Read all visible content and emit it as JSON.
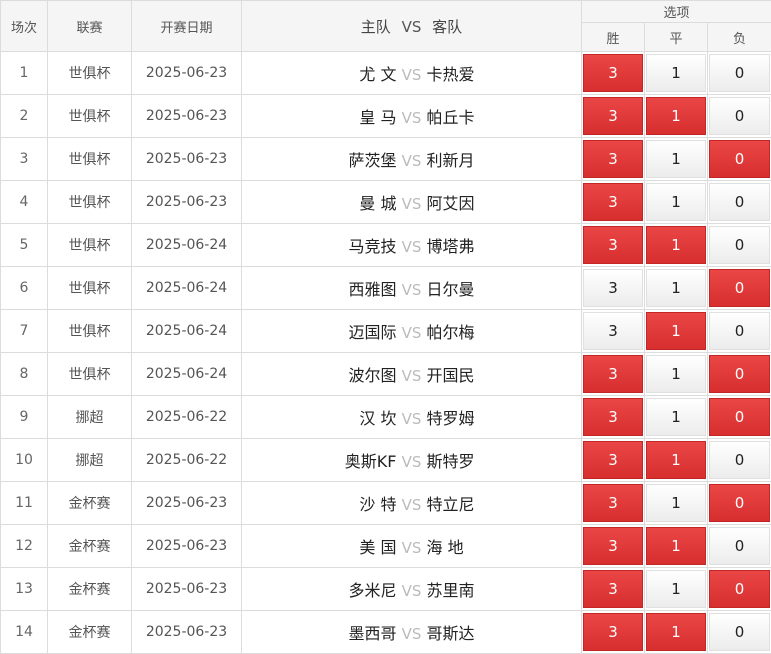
{
  "header": {
    "index_label": "场次",
    "league_label": "联赛",
    "date_label": "开赛日期",
    "home_label": "主队",
    "vs_label": "VS",
    "away_label": "客队",
    "options_label": "选项",
    "win_label": "胜",
    "draw_label": "平",
    "lose_label": "负"
  },
  "vs_text": "VS",
  "selected_color": "#e03c3c",
  "rows": [
    {
      "index": "1",
      "league": "世俱杯",
      "date": "2025-06-23",
      "home": "尤 文",
      "away": "卡热爱",
      "win": "3",
      "draw": "1",
      "lose": "0",
      "win_selected": true,
      "draw_selected": false,
      "lose_selected": false
    },
    {
      "index": "2",
      "league": "世俱杯",
      "date": "2025-06-23",
      "home": "皇 马",
      "away": "帕丘卡",
      "win": "3",
      "draw": "1",
      "lose": "0",
      "win_selected": true,
      "draw_selected": true,
      "lose_selected": false
    },
    {
      "index": "3",
      "league": "世俱杯",
      "date": "2025-06-23",
      "home": "萨茨堡",
      "away": "利新月",
      "win": "3",
      "draw": "1",
      "lose": "0",
      "win_selected": true,
      "draw_selected": false,
      "lose_selected": true
    },
    {
      "index": "4",
      "league": "世俱杯",
      "date": "2025-06-23",
      "home": "曼 城",
      "away": "阿艾因",
      "win": "3",
      "draw": "1",
      "lose": "0",
      "win_selected": true,
      "draw_selected": false,
      "lose_selected": false
    },
    {
      "index": "5",
      "league": "世俱杯",
      "date": "2025-06-24",
      "home": "马竞技",
      "away": "博塔弗",
      "win": "3",
      "draw": "1",
      "lose": "0",
      "win_selected": true,
      "draw_selected": true,
      "lose_selected": false
    },
    {
      "index": "6",
      "league": "世俱杯",
      "date": "2025-06-24",
      "home": "西雅图",
      "away": "日尔曼",
      "win": "3",
      "draw": "1",
      "lose": "0",
      "win_selected": false,
      "draw_selected": false,
      "lose_selected": true
    },
    {
      "index": "7",
      "league": "世俱杯",
      "date": "2025-06-24",
      "home": "迈国际",
      "away": "帕尔梅",
      "win": "3",
      "draw": "1",
      "lose": "0",
      "win_selected": false,
      "draw_selected": true,
      "lose_selected": false
    },
    {
      "index": "8",
      "league": "世俱杯",
      "date": "2025-06-24",
      "home": "波尔图",
      "away": "开国民",
      "win": "3",
      "draw": "1",
      "lose": "0",
      "win_selected": true,
      "draw_selected": false,
      "lose_selected": true
    },
    {
      "index": "9",
      "league": "挪超",
      "date": "2025-06-22",
      "home": "汉 坎",
      "away": "特罗姆",
      "win": "3",
      "draw": "1",
      "lose": "0",
      "win_selected": true,
      "draw_selected": false,
      "lose_selected": true
    },
    {
      "index": "10",
      "league": "挪超",
      "date": "2025-06-22",
      "home": "奥斯KF",
      "away": "斯特罗",
      "win": "3",
      "draw": "1",
      "lose": "0",
      "win_selected": true,
      "draw_selected": true,
      "lose_selected": false
    },
    {
      "index": "11",
      "league": "金杯赛",
      "date": "2025-06-23",
      "home": "沙 特",
      "away": "特立尼",
      "win": "3",
      "draw": "1",
      "lose": "0",
      "win_selected": true,
      "draw_selected": false,
      "lose_selected": true
    },
    {
      "index": "12",
      "league": "金杯赛",
      "date": "2025-06-23",
      "home": "美 国",
      "away": "海 地",
      "win": "3",
      "draw": "1",
      "lose": "0",
      "win_selected": true,
      "draw_selected": true,
      "lose_selected": false
    },
    {
      "index": "13",
      "league": "金杯赛",
      "date": "2025-06-23",
      "home": "多米尼",
      "away": "苏里南",
      "win": "3",
      "draw": "1",
      "lose": "0",
      "win_selected": true,
      "draw_selected": false,
      "lose_selected": true
    },
    {
      "index": "14",
      "league": "金杯赛",
      "date": "2025-06-23",
      "home": "墨西哥",
      "away": "哥斯达",
      "win": "3",
      "draw": "1",
      "lose": "0",
      "win_selected": true,
      "draw_selected": true,
      "lose_selected": false
    }
  ]
}
